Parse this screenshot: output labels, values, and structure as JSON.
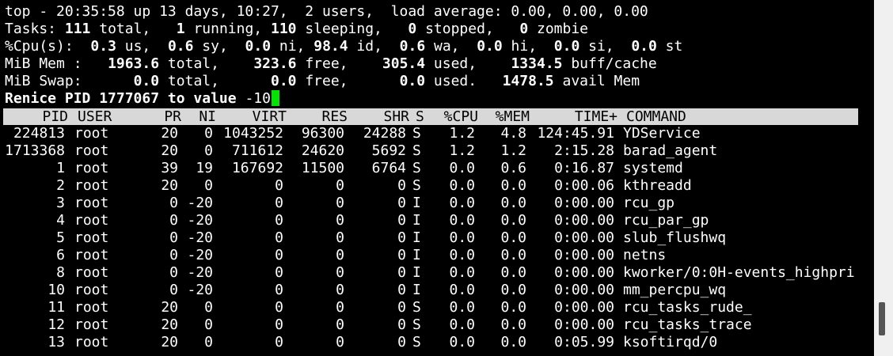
{
  "summary": {
    "line1": "top - 20:35:58 up 13 days, 10:27,  2 users,  load average: 0.00, 0.00, 0.00",
    "tasks": {
      "label": "Tasks:",
      "total": "111",
      "total_l": " total,",
      "running": "1",
      "running_l": " running,",
      "sleeping": "110",
      "sleeping_l": " sleeping,",
      "stopped": "0",
      "stopped_l": " stopped,",
      "zombie": "0",
      "zombie_l": " zombie"
    },
    "cpu": {
      "label": "%Cpu(s):",
      "us": "0.3",
      "us_l": " us,",
      "sy": "0.6",
      "sy_l": " sy,",
      "ni": "0.0",
      "ni_l": " ni,",
      "id": "98.4",
      "id_l": " id,",
      "wa": "0.6",
      "wa_l": " wa,",
      "hi": "0.0",
      "hi_l": " hi,",
      "si": "0.0",
      "si_l": " si,",
      "st": "0.0",
      "st_l": " st"
    },
    "mem": {
      "label": "MiB Mem :",
      "total": "1963.6",
      "total_l": " total,",
      "free": "323.6",
      "free_l": " free,",
      "used": "305.4",
      "used_l": " used,",
      "buff": "1334.5",
      "buff_l": " buff/cache"
    },
    "swap": {
      "label": "MiB Swap:",
      "total": "0.0",
      "total_l": " total,",
      "free": "0.0",
      "free_l": " free,",
      "used": "0.0",
      "used_l": " used.",
      "avail": "1478.5",
      "avail_l": " avail Mem"
    }
  },
  "prompt": {
    "text": "Renice PID 1777067 to value ",
    "input": "-10"
  },
  "columns": [
    "PID",
    "USER",
    "PR",
    "NI",
    "VIRT",
    "RES",
    "SHR",
    "S",
    "%CPU",
    "%MEM",
    "TIME+",
    "COMMAND"
  ],
  "processes": [
    {
      "pid": "224813",
      "user": "root",
      "pr": "20",
      "ni": "0",
      "virt": "1043252",
      "res": "96300",
      "shr": "24288",
      "s": "S",
      "cpu": "1.2",
      "mem": "4.8",
      "time": "124:45.91",
      "cmd": "YDService"
    },
    {
      "pid": "1713368",
      "user": "root",
      "pr": "20",
      "ni": "0",
      "virt": "711612",
      "res": "24620",
      "shr": "5692",
      "s": "S",
      "cpu": "1.2",
      "mem": "1.2",
      "time": "2:15.28",
      "cmd": "barad_agent"
    },
    {
      "pid": "1",
      "user": "root",
      "pr": "39",
      "ni": "19",
      "virt": "167692",
      "res": "11500",
      "shr": "6764",
      "s": "S",
      "cpu": "0.0",
      "mem": "0.6",
      "time": "0:16.87",
      "cmd": "systemd"
    },
    {
      "pid": "2",
      "user": "root",
      "pr": "20",
      "ni": "0",
      "virt": "0",
      "res": "0",
      "shr": "0",
      "s": "S",
      "cpu": "0.0",
      "mem": "0.0",
      "time": "0:00.06",
      "cmd": "kthreadd"
    },
    {
      "pid": "3",
      "user": "root",
      "pr": "0",
      "ni": "-20",
      "virt": "0",
      "res": "0",
      "shr": "0",
      "s": "I",
      "cpu": "0.0",
      "mem": "0.0",
      "time": "0:00.00",
      "cmd": "rcu_gp"
    },
    {
      "pid": "4",
      "user": "root",
      "pr": "0",
      "ni": "-20",
      "virt": "0",
      "res": "0",
      "shr": "0",
      "s": "I",
      "cpu": "0.0",
      "mem": "0.0",
      "time": "0:00.00",
      "cmd": "rcu_par_gp"
    },
    {
      "pid": "5",
      "user": "root",
      "pr": "0",
      "ni": "-20",
      "virt": "0",
      "res": "0",
      "shr": "0",
      "s": "I",
      "cpu": "0.0",
      "mem": "0.0",
      "time": "0:00.00",
      "cmd": "slub_flushwq"
    },
    {
      "pid": "6",
      "user": "root",
      "pr": "0",
      "ni": "-20",
      "virt": "0",
      "res": "0",
      "shr": "0",
      "s": "I",
      "cpu": "0.0",
      "mem": "0.0",
      "time": "0:00.00",
      "cmd": "netns"
    },
    {
      "pid": "8",
      "user": "root",
      "pr": "0",
      "ni": "-20",
      "virt": "0",
      "res": "0",
      "shr": "0",
      "s": "I",
      "cpu": "0.0",
      "mem": "0.0",
      "time": "0:00.00",
      "cmd": "kworker/0:0H-events_highpri"
    },
    {
      "pid": "10",
      "user": "root",
      "pr": "0",
      "ni": "-20",
      "virt": "0",
      "res": "0",
      "shr": "0",
      "s": "I",
      "cpu": "0.0",
      "mem": "0.0",
      "time": "0:00.00",
      "cmd": "mm_percpu_wq"
    },
    {
      "pid": "11",
      "user": "root",
      "pr": "20",
      "ni": "0",
      "virt": "0",
      "res": "0",
      "shr": "0",
      "s": "S",
      "cpu": "0.0",
      "mem": "0.0",
      "time": "0:00.00",
      "cmd": "rcu_tasks_rude_"
    },
    {
      "pid": "12",
      "user": "root",
      "pr": "20",
      "ni": "0",
      "virt": "0",
      "res": "0",
      "shr": "0",
      "s": "S",
      "cpu": "0.0",
      "mem": "0.0",
      "time": "0:00.00",
      "cmd": "rcu_tasks_trace"
    },
    {
      "pid": "13",
      "user": "root",
      "pr": "20",
      "ni": "0",
      "virt": "0",
      "res": "0",
      "shr": "0",
      "s": "S",
      "cpu": "0.0",
      "mem": "0.0",
      "time": "0:05.99",
      "cmd": "ksoftirqd/0"
    }
  ],
  "colors": {
    "background": "#000000",
    "foreground": "#ffffff",
    "header_bg": "#d8d8d8",
    "cursor": "#00e600"
  }
}
